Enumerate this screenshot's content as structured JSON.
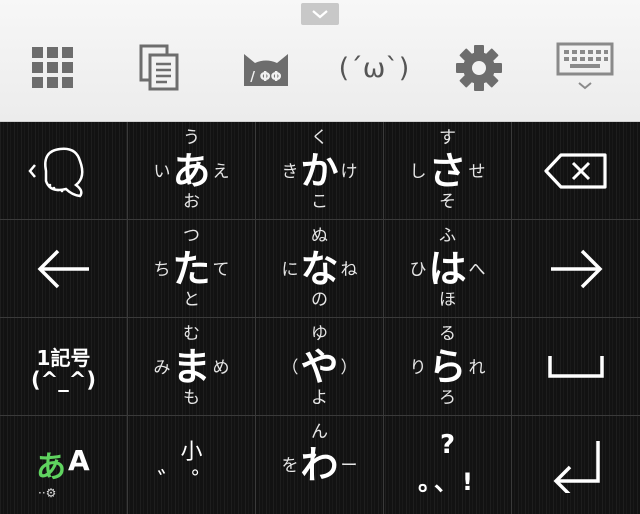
{
  "toolbar": {
    "kaomoji_label": "(´ω`)",
    "icons": [
      "chevron-down-icon",
      "grid-icon",
      "clipboard-icon",
      "cat-face-icon",
      "gear-icon",
      "keyboard-icon"
    ]
  },
  "keys": {
    "a": {
      "main": "あ",
      "up": "う",
      "left": "い",
      "right": "え",
      "down": "お"
    },
    "ka": {
      "main": "か",
      "up": "く",
      "left": "き",
      "right": "け",
      "down": "こ"
    },
    "sa": {
      "main": "さ",
      "up": "す",
      "left": "し",
      "right": "せ",
      "down": "そ"
    },
    "ta": {
      "main": "た",
      "up": "つ",
      "left": "ち",
      "right": "て",
      "down": "と"
    },
    "na": {
      "main": "な",
      "up": "ぬ",
      "left": "に",
      "right": "ね",
      "down": "の"
    },
    "ha": {
      "main": "は",
      "up": "ふ",
      "left": "ひ",
      "right": "へ",
      "down": "ほ"
    },
    "ma": {
      "main": "ま",
      "up": "む",
      "left": "み",
      "right": "め",
      "down": "も"
    },
    "ya": {
      "main": "や",
      "up": "ゆ",
      "left": "（",
      "right": "）",
      "down": "よ"
    },
    "ra": {
      "main": "ら",
      "up": "る",
      "left": "り",
      "right": "れ",
      "down": "ろ"
    },
    "wa": {
      "main": "わ",
      "up": "ん",
      "left": "を",
      "right": "ー"
    }
  },
  "symbol_key": {
    "line1": "1記号",
    "line2": "(^_^)"
  },
  "mode_key": {
    "kana": "あ",
    "alpha": "A",
    "settings_hint": "··⚙",
    "kana_color": "#5fd35f"
  },
  "small_key": {
    "top": "小",
    "marks": "゛゜"
  },
  "punct_key": {
    "top": "?",
    "bottom": "。、!"
  }
}
